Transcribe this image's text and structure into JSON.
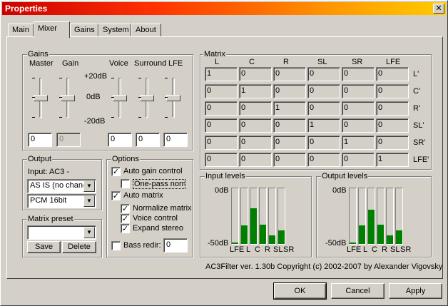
{
  "window": {
    "title": "Properties",
    "close_glyph": "✕"
  },
  "tabs": [
    {
      "label": "Main"
    },
    {
      "label": "Mixer"
    },
    {
      "label": "Gains"
    },
    {
      "label": "System"
    },
    {
      "label": "About"
    }
  ],
  "active_tab": "Mixer",
  "gains": {
    "group_label": "Gains",
    "headers": {
      "master": "Master",
      "gain": "Gain",
      "voice": "Voice",
      "surround": "Surround",
      "lfe": "LFE"
    },
    "scale": {
      "top": "+20dB",
      "mid": "0dB",
      "bottom": "-20dB"
    },
    "values": {
      "master": "0",
      "gain": "0",
      "voice": "0",
      "surround": "0",
      "lfe": "0"
    },
    "slider_db": {
      "master": 0,
      "gain": 0,
      "voice": 0,
      "surround": 0,
      "lfe": 0
    }
  },
  "output": {
    "group_label": "Output",
    "input_text": "Input: AC3 -",
    "speakers": "AS IS (no change)",
    "format": "PCM 16bit"
  },
  "matrix_preset": {
    "group_label": "Matrix preset",
    "selected": "",
    "save": "Save",
    "delete": "Delete"
  },
  "options": {
    "group_label": "Options",
    "auto_gain": {
      "label": "Auto gain control",
      "checked": true
    },
    "one_pass": {
      "label": "One-pass norm",
      "checked": false
    },
    "auto_matrix": {
      "label": "Auto matrix",
      "checked": true
    },
    "normalize": {
      "label": "Normalize matrix",
      "checked": true
    },
    "voice_control": {
      "label": "Voice control",
      "checked": true
    },
    "expand_stereo": {
      "label": "Expand stereo",
      "checked": true
    },
    "bass_redir": {
      "label": "Bass redir:",
      "checked": false,
      "value": "0"
    }
  },
  "matrix": {
    "group_label": "Matrix",
    "cols": [
      "L",
      "C",
      "R",
      "SL",
      "SR",
      "LFE"
    ],
    "rows": [
      "L'",
      "C'",
      "R'",
      "SL'",
      "SR'",
      "LFE'"
    ],
    "cells": [
      [
        "1",
        "0",
        "0",
        "0",
        "0",
        "0"
      ],
      [
        "0",
        "1",
        "0",
        "0",
        "0",
        "0"
      ],
      [
        "0",
        "0",
        "1",
        "0",
        "0",
        "0"
      ],
      [
        "0",
        "0",
        "0",
        "1",
        "0",
        "0"
      ],
      [
        "0",
        "0",
        "0",
        "0",
        "1",
        "0"
      ],
      [
        "0",
        "0",
        "0",
        "0",
        "0",
        "1"
      ]
    ]
  },
  "input_levels": {
    "group_label": "Input levels",
    "top": "0dB",
    "bottom": "-50dB",
    "channels": [
      "LFE",
      "L",
      "C",
      "R",
      "SL",
      "SR"
    ],
    "levels": [
      0.03,
      0.33,
      0.64,
      0.34,
      0.15,
      0.24
    ]
  },
  "output_levels": {
    "group_label": "Output levels",
    "top": "0dB",
    "bottom": "-50dB",
    "channels": [
      "LFE",
      "L",
      "C",
      "R",
      "SL",
      "SR"
    ],
    "levels": [
      0.03,
      0.33,
      0.62,
      0.34,
      0.15,
      0.24
    ]
  },
  "footer_text": "AC3Filter ver. 1.30b Copyright (c) 2002-2007 by Alexander Vigovsky",
  "buttons": {
    "ok": "OK",
    "cancel": "Cancel",
    "apply": "Apply"
  },
  "colors": {
    "meter_fill": "#008000",
    "titlebar_start": "#cc0000",
    "titlebar_end": "#ffcc00"
  }
}
